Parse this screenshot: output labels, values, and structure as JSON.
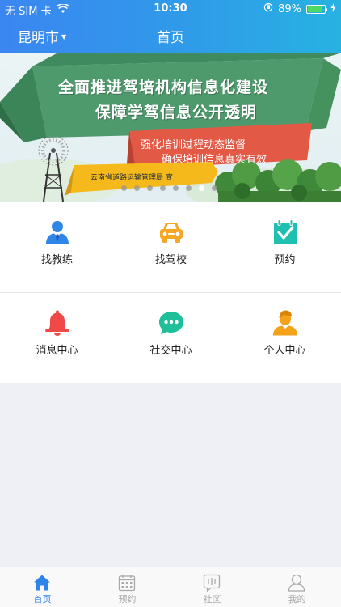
{
  "status_bar": {
    "carrier": "无 SIM 卡",
    "time": "10:30",
    "battery_percent": "89%",
    "battery_level": 0.89
  },
  "nav": {
    "city": "昆明市",
    "title": "首页"
  },
  "banner": {
    "headline_1": "全面推进驾培机构信息化建设",
    "headline_2": "保障学驾信息公开透明",
    "tagline_1": "强化培训过程动态监督",
    "tagline_2": "确保培训信息真实有效",
    "publisher": "云南省道路运输管理局 宣",
    "slide_count": 8,
    "active_slide": 7
  },
  "grid": [
    {
      "label": "找教练",
      "icon": "coach-icon",
      "color": "#2f86e8"
    },
    {
      "label": "找驾校",
      "icon": "car-icon",
      "color": "#f5a623"
    },
    {
      "label": "预约",
      "icon": "calendar-check-icon",
      "color": "#1fc0b0"
    },
    {
      "label": "消息中心",
      "icon": "bell-icon",
      "color": "#f04a48"
    },
    {
      "label": "社交中心",
      "icon": "chat-bubble-icon",
      "color": "#1fbf9a"
    },
    {
      "label": "个人中心",
      "icon": "person-icon",
      "color": "#f5a21b"
    }
  ],
  "tabbar": [
    {
      "label": "首页",
      "icon": "home-icon",
      "active": true
    },
    {
      "label": "预约",
      "icon": "calendar-icon",
      "active": false
    },
    {
      "label": "社区",
      "icon": "community-icon",
      "active": false
    },
    {
      "label": "我的",
      "icon": "user-icon",
      "active": false
    }
  ],
  "colors": {
    "accent": "#2f84ea",
    "tab_inactive": "#a9a9a9",
    "page_background": "#eef0f5"
  }
}
